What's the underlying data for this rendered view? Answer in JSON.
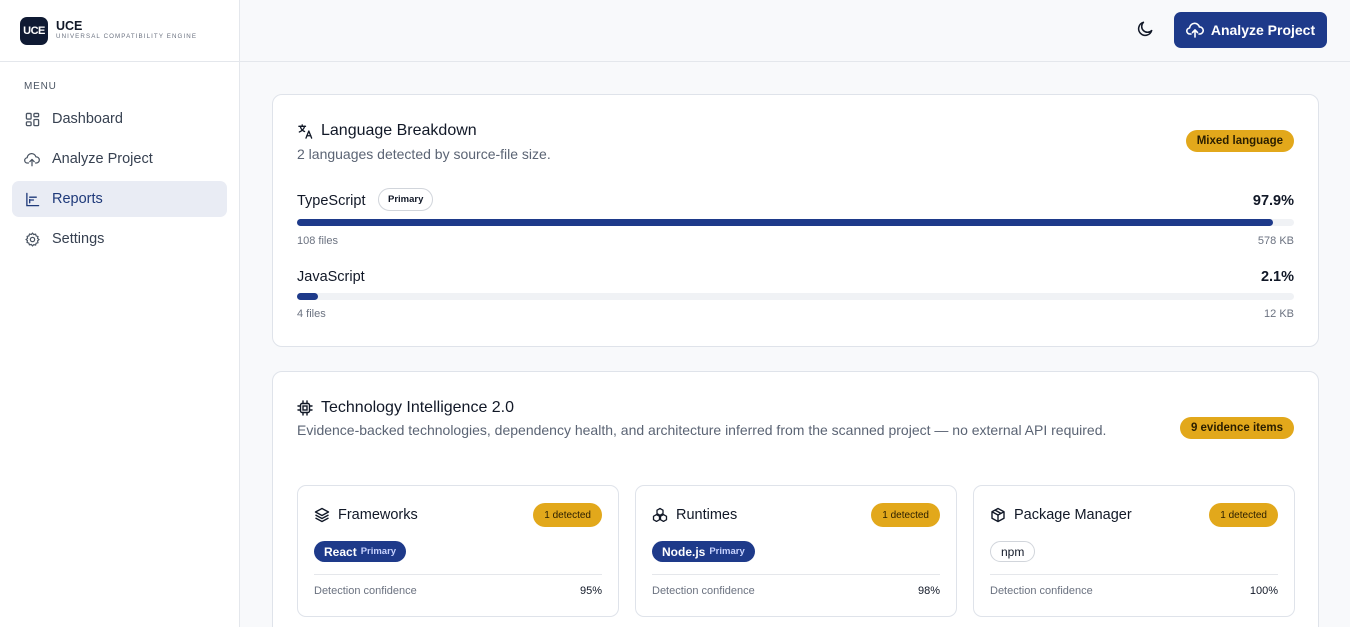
{
  "brand": {
    "logo_text": "UCE",
    "name": "UCE",
    "subtitle": "UNIVERSAL COMPATIBILITY ENGINE"
  },
  "sidebar": {
    "menu_label": "MENU",
    "items": [
      {
        "label": "Dashboard",
        "icon": "grid-icon",
        "active": false
      },
      {
        "label": "Analyze Project",
        "icon": "cloud-upload-icon",
        "active": false
      },
      {
        "label": "Reports",
        "icon": "bar-chart-icon",
        "active": true
      },
      {
        "label": "Settings",
        "icon": "gear-icon",
        "active": false
      }
    ]
  },
  "header": {
    "theme_toggle_icon": "moon-icon",
    "analyze_button": "Analyze Project"
  },
  "language_card": {
    "title": "Language Breakdown",
    "subtitle": "2 languages detected by source-file size.",
    "badge": "Mixed language",
    "languages": [
      {
        "name": "TypeScript",
        "badge": "Primary",
        "percent": "97.9%",
        "fraction": 0.979,
        "files": "108 files",
        "size": "578 KB"
      },
      {
        "name": "JavaScript",
        "badge": "",
        "percent": "2.1%",
        "fraction": 0.021,
        "files": "4 files",
        "size": "12 KB"
      }
    ]
  },
  "tech_card": {
    "title": "Technology Intelligence 2.0",
    "subtitle": "Evidence-backed technologies, dependency health, and architecture inferred from the scanned project — no external API required.",
    "badge": "9 evidence items",
    "boxes": [
      {
        "title": "Frameworks",
        "icon": "layers-icon",
        "count": "1 detected",
        "item": "React",
        "item_sub": "Primary",
        "confidence_label": "Detection confidence",
        "confidence": "95%"
      },
      {
        "title": "Runtimes",
        "icon": "boxes-icon",
        "count": "1 detected",
        "item": "Node.js",
        "item_sub": "Primary",
        "confidence_label": "Detection confidence",
        "confidence": "98%"
      },
      {
        "title": "Package Manager",
        "icon": "package-icon",
        "count": "1 detected",
        "item": "npm",
        "item_sub": "",
        "confidence_label": "Detection confidence",
        "confidence": "100%"
      }
    ]
  },
  "colors": {
    "primary": "#1e3a8a",
    "accent": "#e2a81b",
    "active_nav": "#e9ecf4"
  }
}
